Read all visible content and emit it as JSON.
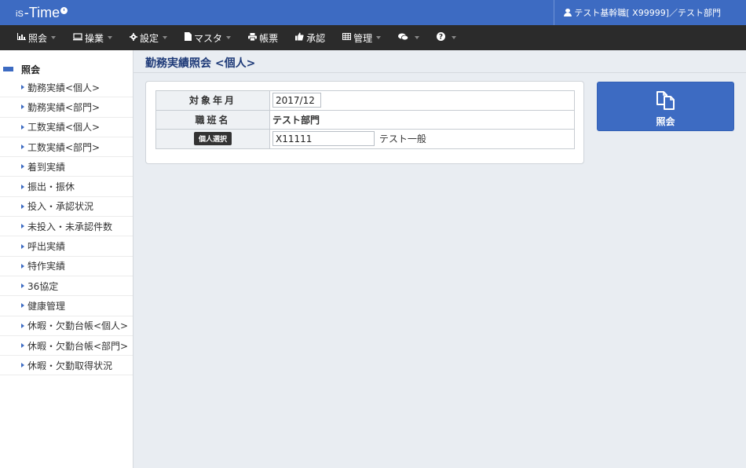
{
  "header": {
    "logo_prefix": "iS",
    "logo_main": "-Time",
    "user": "テスト基幹職[ X99999]／テスト部門"
  },
  "menu": [
    {
      "icon": "bar-chart-icon",
      "label": "照会",
      "dropdown": true
    },
    {
      "icon": "monitor-icon",
      "label": "操業",
      "dropdown": true
    },
    {
      "icon": "gear-icon",
      "label": "設定",
      "dropdown": true
    },
    {
      "icon": "file-icon",
      "label": "マスタ",
      "dropdown": true
    },
    {
      "icon": "printer-icon",
      "label": "帳票",
      "dropdown": false
    },
    {
      "icon": "thumbs-up-icon",
      "label": "承認",
      "dropdown": false
    },
    {
      "icon": "table-icon",
      "label": "管理",
      "dropdown": true
    },
    {
      "icon": "comments-icon",
      "label": "",
      "dropdown": true
    },
    {
      "icon": "question-icon",
      "label": "",
      "dropdown": true
    }
  ],
  "sidebar": {
    "heading": "照会",
    "items": [
      "勤務実績<個人>",
      "勤務実績<部門>",
      "工数実績<個人>",
      "工数実績<部門>",
      "着到実績",
      "振出・振休",
      "投入・承認状況",
      "未投入・未承認件数",
      "呼出実績",
      "特作実績",
      "36協定",
      "健康管理",
      "休暇・欠勤台帳<個人>",
      "休暇・欠勤台帳<部門>",
      "休暇・欠勤取得状況"
    ]
  },
  "page": {
    "title": "勤務実績照会 <個人>"
  },
  "form": {
    "target_month_label": "対象年月",
    "target_month_value": "2017/12",
    "dept_label": "職班名",
    "dept_value": "テスト部門",
    "select_button": "個人選択",
    "employee_id": "X11111",
    "employee_name": "テスト一般"
  },
  "query_button": {
    "icon": "copy-icon",
    "label": "照会"
  },
  "colors": {
    "header_bg": "#3d6bc2",
    "menubar_bg": "#2b2b2b",
    "content_bg": "#e9edf2",
    "accent": "#3d6bc2",
    "title": "#1e3a78"
  }
}
